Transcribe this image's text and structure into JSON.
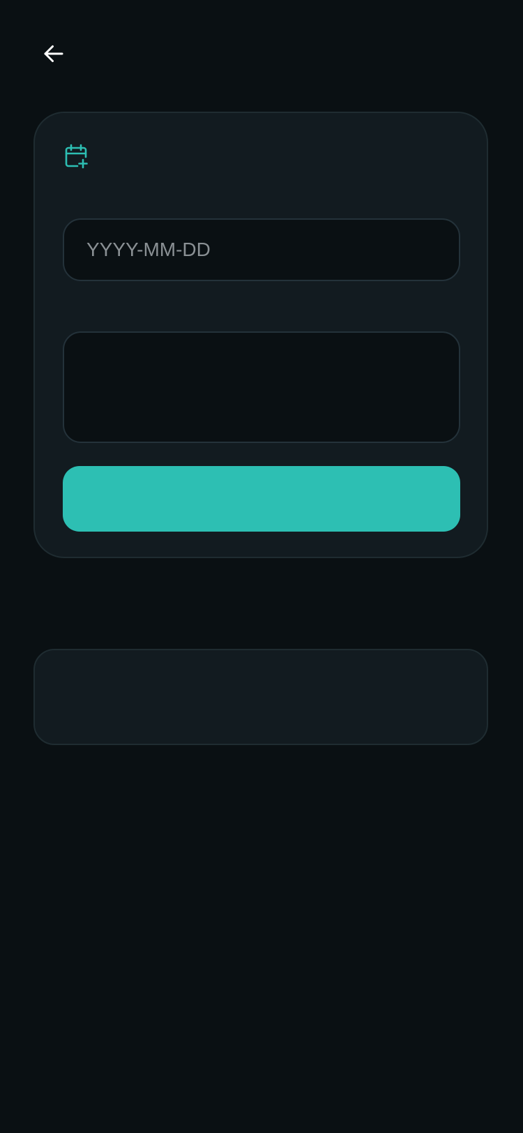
{
  "header": {
    "back_icon": "arrow-left-icon"
  },
  "form": {
    "icon": "calendar-plus-icon",
    "accent_color": "#2dbfb3",
    "date_input": {
      "value": "",
      "placeholder": "YYYY-MM-DD"
    },
    "notes_input": {
      "value": "",
      "placeholder": ""
    },
    "submit_label": ""
  },
  "list": {
    "items": []
  }
}
